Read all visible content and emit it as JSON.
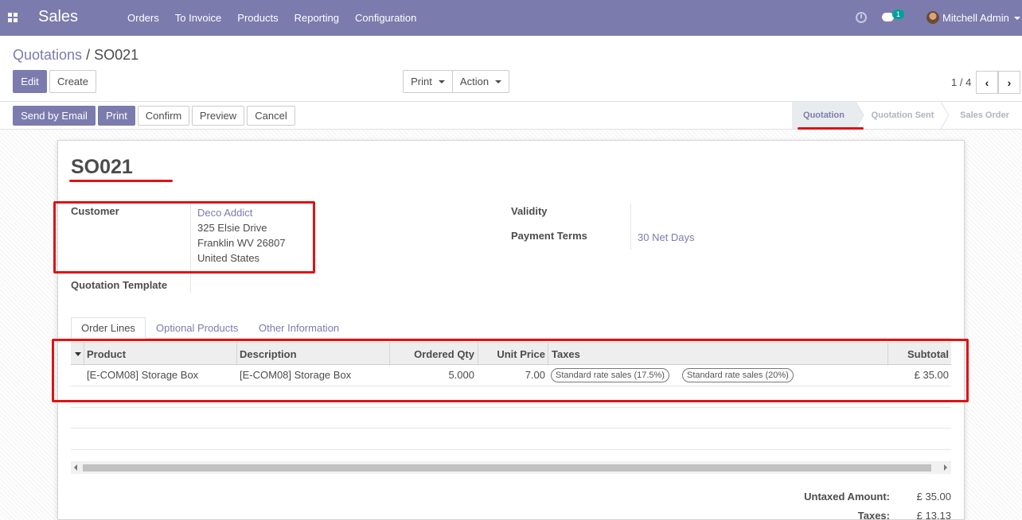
{
  "navbar": {
    "app_title": "Sales",
    "menu": [
      "Orders",
      "To Invoice",
      "Products",
      "Reporting",
      "Configuration"
    ],
    "chat_count": "1",
    "user_name": "Mitchell Admin",
    "color": "#7c7bad"
  },
  "breadcrumb": {
    "parent": "Quotations",
    "separator": "/",
    "current": "SO021"
  },
  "toolbar": {
    "edit": "Edit",
    "create": "Create",
    "print": "Print",
    "action": "Action",
    "pager": "1 / 4"
  },
  "statusbar": {
    "buttons": {
      "send_email": "Send by Email",
      "print": "Print",
      "confirm": "Confirm",
      "preview": "Preview",
      "cancel": "Cancel"
    },
    "stages": [
      "Quotation",
      "Quotation Sent",
      "Sales Order"
    ],
    "active_stage": "Quotation"
  },
  "form": {
    "title": "SO021",
    "customer_label": "Customer",
    "customer_name": "Deco Addict",
    "customer_address": [
      "325 Elsie Drive",
      "Franklin WV 26807",
      "United States"
    ],
    "template_label": "Quotation Template",
    "validity_label": "Validity",
    "payment_terms_label": "Payment Terms",
    "payment_terms_value": "30 Net Days"
  },
  "tabs": [
    "Order Lines",
    "Optional Products",
    "Other Information"
  ],
  "order_lines": {
    "columns": [
      "Product",
      "Description",
      "Ordered Qty",
      "Unit Price",
      "Taxes",
      "Subtotal"
    ],
    "rows": [
      {
        "product": "[E-COM08] Storage Box",
        "description": "[E-COM08] Storage Box",
        "qty": "5.000",
        "unit_price": "7.00",
        "taxes": [
          "Standard rate sales (17.5%)",
          "Standard rate sales (20%)"
        ],
        "subtotal": "£ 35.00"
      }
    ]
  },
  "totals": {
    "untaxed_label": "Untaxed Amount:",
    "untaxed_value": "£ 35.00",
    "taxes_label": "Taxes:",
    "taxes_value": "£ 13.13"
  },
  "annotation_color": "#e01313"
}
